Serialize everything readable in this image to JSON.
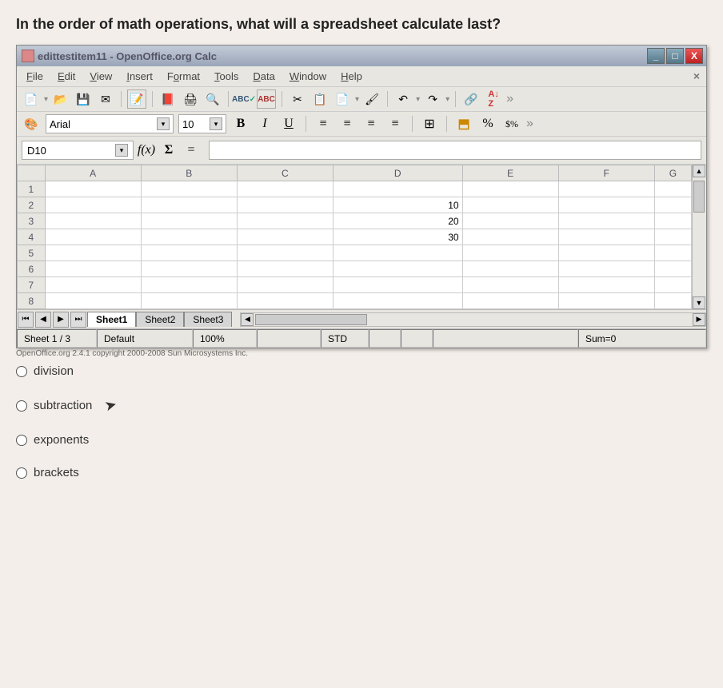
{
  "question": "In the order of math operations, what will a spreadsheet calculate last?",
  "window_title": "edittestitem11 - OpenOffice.org Calc",
  "menu": [
    "File",
    "Edit",
    "View",
    "Insert",
    "Format",
    "Tools",
    "Data",
    "Window",
    "Help"
  ],
  "font_name": "Arial",
  "font_size": "10",
  "cell_ref": "D10",
  "columns": [
    "A",
    "B",
    "C",
    "D",
    "E",
    "F",
    "G"
  ],
  "rows": [
    1,
    2,
    3,
    4,
    5,
    6,
    7,
    8
  ],
  "cells": {
    "D2": "10",
    "D3": "20",
    "D4": "30"
  },
  "tabs": [
    "Sheet1",
    "Sheet2",
    "Sheet3"
  ],
  "active_tab": "Sheet1",
  "status": {
    "sheet": "Sheet 1 / 3",
    "style": "Default",
    "zoom": "100%",
    "mode": "STD",
    "sum": "Sum=0"
  },
  "copyright": "OpenOffice.org 2.4.1 copyright 2000-2008 Sun Microsystems Inc.",
  "answers": [
    "division",
    "subtraction",
    "exponents",
    "brackets"
  ],
  "format_icons": {
    "bold": "B",
    "italic": "I",
    "underline": "U",
    "percent": "%",
    "currency": "$%"
  }
}
